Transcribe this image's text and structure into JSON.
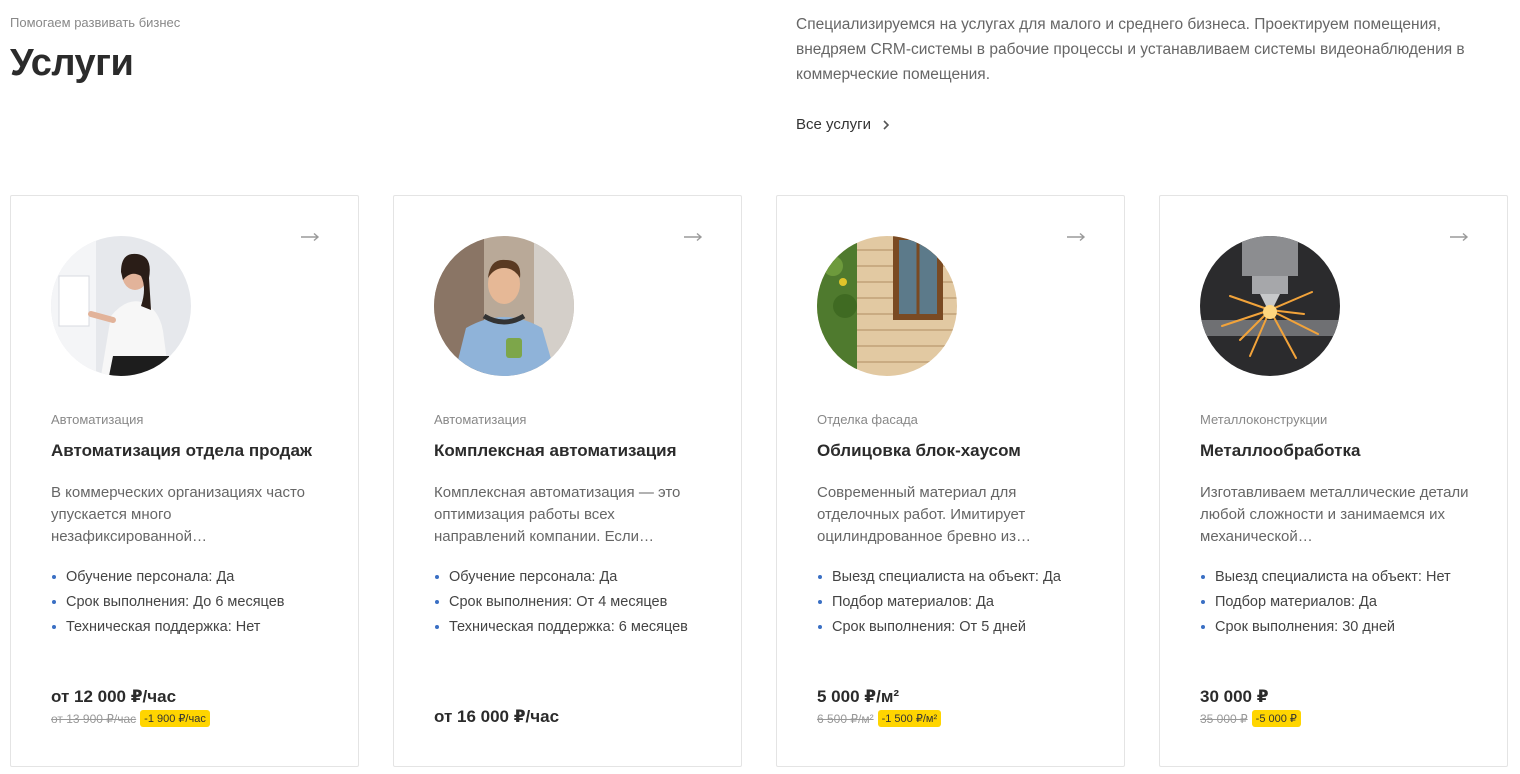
{
  "header": {
    "eyebrow": "Помогаем развивать бизнес",
    "title": "Услуги",
    "intro": "Специализируемся на услугах для малого и среднего бизнеса. Проектируем помещения, внедряем CRM-системы в рабочие процессы и устанавливаем системы видеонаблюдения в коммерческие помещения.",
    "all_link": "Все услуги"
  },
  "colors": {
    "accent_bullet": "#3a6fc4",
    "discount_badge": "#ffd500"
  },
  "cards": [
    {
      "category": "Автоматизация",
      "title": "Автоматизация отдела продаж",
      "description": "В коммерческих организациях часто упускается много незафиксированной…",
      "props": [
        "Обучение персонала:  Да",
        "Срок выполнения:  До 6 месяцев",
        "Техническая поддержка:  Нет"
      ],
      "price": "от 12 000 ₽/час",
      "old_price": "от 13 900 ₽/час",
      "discount": "-1 900 ₽/час",
      "image": "woman-presenting-photo"
    },
    {
      "category": "Автоматизация",
      "title": "Комплексная автоматизация",
      "description": "Комплексная автоматизация — это оптимизация работы всех направлений компании. Если…",
      "props": [
        "Обучение персонала:  Да",
        "Срок выполнения:  От 4 месяцев",
        "Техническая поддержка:  6 месяцев"
      ],
      "price": "от 16 000 ₽/час",
      "image": "man-with-coffee-photo"
    },
    {
      "category": "Отделка фасада",
      "title": "Облицовка блок-хаусом",
      "description": "Современный материал для отделочных работ. Имитирует оцилиндрованное бревно из…",
      "props": [
        "Выезд специалиста на объект:  Да",
        "Подбор материалов:  Да",
        "Срок выполнения:  От 5 дней"
      ],
      "price": "5 000 ₽/м²",
      "old_price": "6 500 ₽/м²",
      "discount": "-1 500 ₽/м²",
      "image": "wooden-facade-photo"
    },
    {
      "category": "Металлоконструкции",
      "title": "Металлообработка",
      "description": "Изготавливаем металлические детали любой сложности и занимаемся их механической…",
      "props": [
        "Выезд специалиста на объект:  Нет",
        "Подбор материалов:  Да",
        "Срок выполнения:  30 дней"
      ],
      "price": "30 000 ₽",
      "old_price": "35 000 ₽",
      "discount": "-5 000 ₽",
      "image": "metal-cutting-sparks-photo"
    }
  ]
}
